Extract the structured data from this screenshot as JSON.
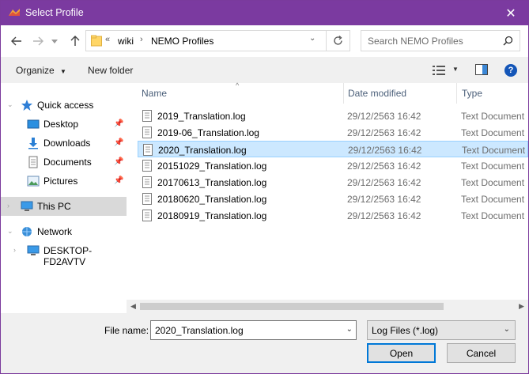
{
  "window": {
    "title": "Select Profile",
    "close_glyph": "✕"
  },
  "address": {
    "overflow_glyph": "«",
    "crumbs": [
      "wiki",
      "NEMO Profiles"
    ]
  },
  "search": {
    "placeholder": "Search NEMO Profiles"
  },
  "toolbar": {
    "organize_label": "Organize",
    "new_folder_label": "New folder"
  },
  "nav": {
    "items": [
      {
        "label": "Quick access",
        "icon": "star-icon"
      },
      {
        "label": "Desktop",
        "icon": "desktop-icon"
      },
      {
        "label": "Downloads",
        "icon": "download-icon"
      },
      {
        "label": "Documents",
        "icon": "documents-icon"
      },
      {
        "label": "Pictures",
        "icon": "pictures-icon"
      },
      {
        "label": "This PC",
        "icon": "computer-icon"
      },
      {
        "label": "Network",
        "icon": "network-icon"
      },
      {
        "label": "DESKTOP-FD2AVTV",
        "icon": "computer-icon"
      }
    ]
  },
  "columns": {
    "name": "Name",
    "date": "Date modified",
    "type": "Type"
  },
  "files": [
    {
      "name": "2019_Translation.log",
      "date": "29/12/2563 16:42",
      "type": "Text Document"
    },
    {
      "name": "2019-06_Translation.log",
      "date": "29/12/2563 16:42",
      "type": "Text Document"
    },
    {
      "name": "2020_Translation.log",
      "date": "29/12/2563 16:42",
      "type": "Text Document"
    },
    {
      "name": "20151029_Translation.log",
      "date": "29/12/2563 16:42",
      "type": "Text Document"
    },
    {
      "name": "20170613_Translation.log",
      "date": "29/12/2563 16:42",
      "type": "Text Document"
    },
    {
      "name": "20180620_Translation.log",
      "date": "29/12/2563 16:42",
      "type": "Text Document"
    },
    {
      "name": "20180919_Translation.log",
      "date": "29/12/2563 16:42",
      "type": "Text Document"
    }
  ],
  "selected_file_index": 2,
  "bottom": {
    "file_name_label": "File name:",
    "file_name_value": "2020_Translation.log",
    "file_type_value": "Log Files (*.log)",
    "open_label": "Open",
    "cancel_label": "Cancel"
  },
  "colors": {
    "titlebar": "#7b3aa0",
    "selection": "#cce8ff",
    "accent": "#0078d7"
  }
}
